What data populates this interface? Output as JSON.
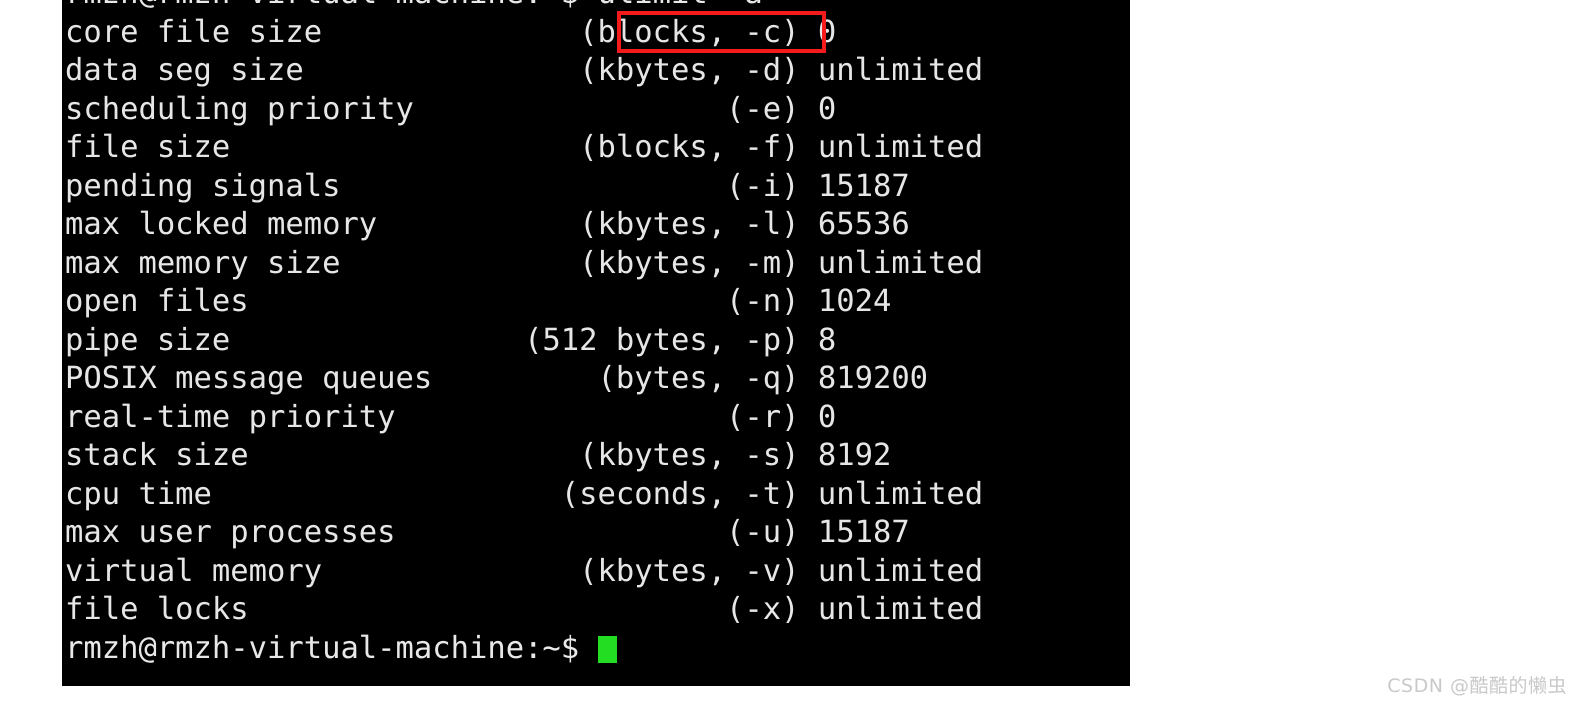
{
  "terminal": {
    "background_color": "#000000",
    "foreground_color": "#e6e6e6",
    "cursor_color": "#22dd22",
    "prompt": "rmzh@rmzh-virtual-machine:~$",
    "command": "ulimit -a",
    "prompt_line": "rmzh@rmzh-virtual-machine:~$ ulimit -a",
    "last_prompt_line": "rmzh@rmzh-virtual-machine:~$ ",
    "lines": [
      "rmzh@rmzh-virtual-machine:~$ ulimit -a",
      "core file size              (blocks, -c) 0",
      "data seg size               (kbytes, -d) unlimited",
      "scheduling priority                 (-e) 0",
      "file size                   (blocks, -f) unlimited",
      "pending signals                     (-i) 15187",
      "max locked memory           (kbytes, -l) 65536",
      "max memory size             (kbytes, -m) unlimited",
      "open files                          (-n) 1024",
      "pipe size                (512 bytes, -p) 8",
      "POSIX message queues         (bytes, -q) 819200",
      "real-time priority                  (-r) 0",
      "stack size                  (kbytes, -s) 8192",
      "cpu time                   (seconds, -t) unlimited",
      "max user processes                  (-u) 15187",
      "virtual memory              (kbytes, -v) unlimited",
      "file locks                          (-x) unlimited"
    ],
    "limits": [
      {
        "name": "core file size",
        "unit": "blocks",
        "flag": "-c",
        "value": "0"
      },
      {
        "name": "data seg size",
        "unit": "kbytes",
        "flag": "-d",
        "value": "unlimited"
      },
      {
        "name": "scheduling priority",
        "unit": "",
        "flag": "-e",
        "value": "0"
      },
      {
        "name": "file size",
        "unit": "blocks",
        "flag": "-f",
        "value": "unlimited"
      },
      {
        "name": "pending signals",
        "unit": "",
        "flag": "-i",
        "value": "15187"
      },
      {
        "name": "max locked memory",
        "unit": "kbytes",
        "flag": "-l",
        "value": "65536"
      },
      {
        "name": "max memory size",
        "unit": "kbytes",
        "flag": "-m",
        "value": "unlimited"
      },
      {
        "name": "open files",
        "unit": "",
        "flag": "-n",
        "value": "1024"
      },
      {
        "name": "pipe size",
        "unit": "512 bytes",
        "flag": "-p",
        "value": "8"
      },
      {
        "name": "POSIX message queues",
        "unit": "bytes",
        "flag": "-q",
        "value": "819200"
      },
      {
        "name": "real-time priority",
        "unit": "",
        "flag": "-r",
        "value": "0"
      },
      {
        "name": "stack size",
        "unit": "kbytes",
        "flag": "-s",
        "value": "8192"
      },
      {
        "name": "cpu time",
        "unit": "seconds",
        "flag": "-t",
        "value": "unlimited"
      },
      {
        "name": "max user processes",
        "unit": "",
        "flag": "-u",
        "value": "15187"
      },
      {
        "name": "virtual memory",
        "unit": "kbytes",
        "flag": "-v",
        "value": "unlimited"
      },
      {
        "name": "file locks",
        "unit": "",
        "flag": "-x",
        "value": "unlimited"
      }
    ]
  },
  "annotation": {
    "color": "#f31b1b",
    "target_text": "ulimit -a"
  },
  "watermark": {
    "text": "CSDN @酷酷的懒虫",
    "color": "#c9c9c9"
  }
}
